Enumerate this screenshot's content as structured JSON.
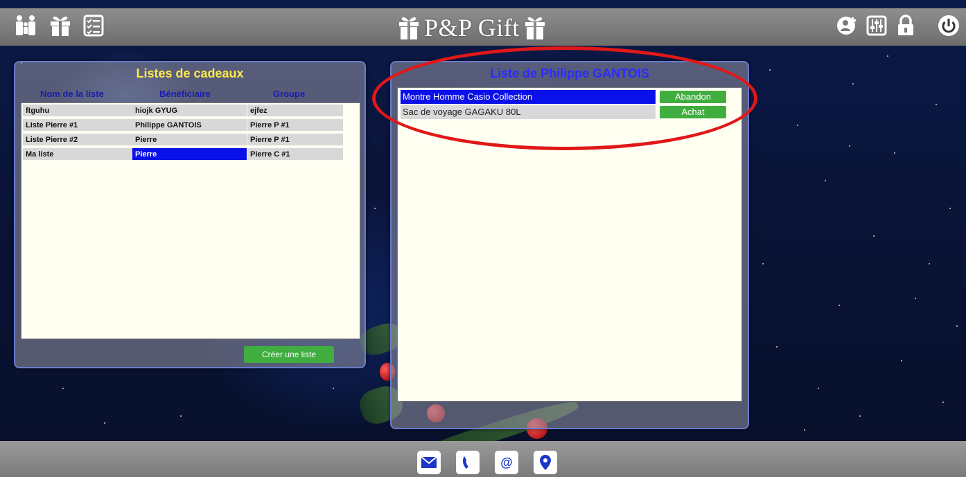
{
  "header": {
    "title": "P&P Gift",
    "left_icons": [
      "family-icon",
      "gift-icon",
      "checklist-icon"
    ],
    "right_icons": [
      "add-user-icon",
      "settings-sliders-icon",
      "lock-icon",
      "power-icon"
    ]
  },
  "lists_panel": {
    "title": "Listes de cadeaux",
    "columns": [
      "Nom de la liste",
      "Bénéficiaire",
      "Groupe"
    ],
    "rows": [
      {
        "name": "ftguhu",
        "beneficiary": "hiojk GYUG",
        "group": "ejfez"
      },
      {
        "name": "Liste Pierre #1",
        "beneficiary": "Philippe GANTOIS",
        "group": "Pierre P #1"
      },
      {
        "name": "Liste Pierre #2",
        "beneficiary": "Pierre",
        "group": "Pierre P #1"
      },
      {
        "name": "Ma liste",
        "beneficiary": "Pierre",
        "group": "Pierre C #1"
      }
    ],
    "create_button": "Créer une liste"
  },
  "gifts_panel": {
    "title": "Liste de Philippe GANTOIS",
    "items": [
      {
        "name": "Montre Homme Casio Collection",
        "action": "Abandon"
      },
      {
        "name": "Sac de voyage GAGAKU 80L",
        "action": "Achat"
      }
    ]
  },
  "footer": {
    "icons": [
      "mail-icon",
      "phone-icon",
      "at-icon",
      "location-pin-icon"
    ],
    "at_glyph": "@"
  },
  "colors": {
    "accent_green": "#3fae3f",
    "selection_blue": "#0a10e8",
    "title_yellow": "#ffe94a",
    "title_blue": "#2b2bff",
    "highlight_red": "#e01818"
  }
}
